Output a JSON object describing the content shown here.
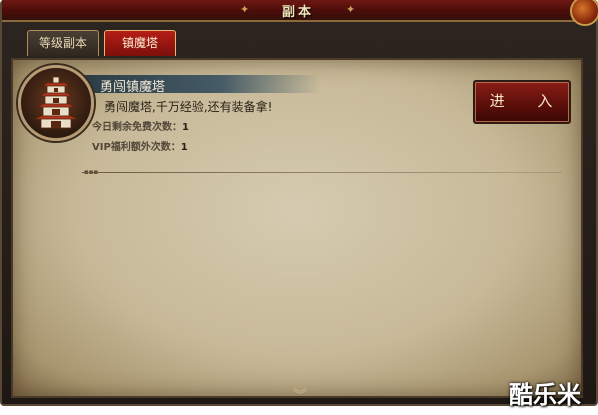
{
  "window": {
    "title": "副本",
    "close_icon": "corner-knob-icon"
  },
  "tabs": [
    {
      "label": "等级副本",
      "active": false
    },
    {
      "label": "镇魔塔",
      "active": true
    }
  ],
  "quest": {
    "title": "勇闯镇魔塔",
    "icon": "pagoda-icon",
    "description": "勇闯魔塔,千万经验,还有装备拿!",
    "stats": [
      {
        "label": "今日剩余免费次数：",
        "value": "1"
      },
      {
        "label": "VIP福利额外次数：",
        "value": "1"
      }
    ],
    "enter_label": "进 入"
  },
  "footer": {
    "scroll_icon": "double-chevron-down-icon"
  },
  "watermark": "酷乐米",
  "colors": {
    "title_bar": "#6e1812",
    "active_tab": "#b51e16",
    "parchment": "#c7b998",
    "enter_button": "#8a1e16"
  }
}
